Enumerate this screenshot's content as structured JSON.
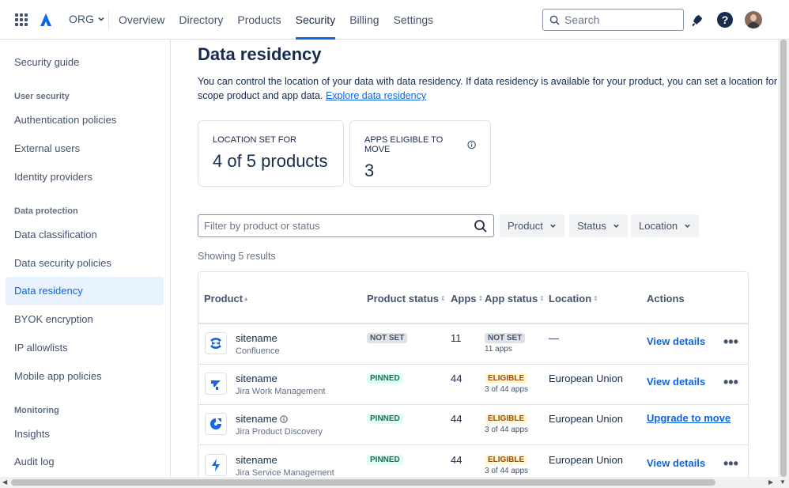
{
  "topnav": {
    "org_label": "ORG",
    "links": [
      "Overview",
      "Directory",
      "Products",
      "Security",
      "Billing",
      "Settings"
    ],
    "active_link": "Security",
    "search_placeholder": "Search",
    "help_glyph": "?",
    "accent_color": "#0c66e4"
  },
  "sidebar": {
    "security_guide": "Security guide",
    "user_security_heading": "User security",
    "authentication_policies": "Authentication policies",
    "external_users": "External users",
    "identity_providers": "Identity providers",
    "data_protection_heading": "Data protection",
    "data_classification": "Data classification",
    "data_security_policies": "Data security policies",
    "data_residency": "Data residency",
    "byok_encryption": "BYOK encryption",
    "ip_allowlists": "IP allowlists",
    "mobile_app_policies": "Mobile app policies",
    "monitoring_heading": "Monitoring",
    "insights": "Insights",
    "audit_log": "Audit log"
  },
  "main": {
    "title": "Data residency",
    "description": "You can control the location of your data with data residency. If data residency is available for your product, you can set a location for in-scope product and app data.",
    "description_link": "Explore data residency",
    "card_location": {
      "label": "LOCATION SET FOR",
      "value": "4 of 5 products"
    },
    "card_apps": {
      "label": "APPS ELIGIBLE TO MOVE",
      "value": "3"
    },
    "filter_placeholder": "Filter by product or status",
    "dropdowns": {
      "product": "Product",
      "status": "Status",
      "location": "Location"
    },
    "showing": "Showing 5 results"
  },
  "table": {
    "headers": {
      "product": "Product",
      "product_status": "Product status",
      "apps": "Apps",
      "app_status": "App status",
      "location": "Location",
      "actions": "Actions"
    },
    "rows": [
      {
        "name": "sitename",
        "product": "Confluence",
        "status": "NOT SET",
        "apps": "11",
        "app_status": "NOT SET",
        "app_sub": "11 apps",
        "location": "—",
        "action": "View details",
        "icon": "confluence-icon"
      },
      {
        "name": "sitename",
        "product": "Jira Work Management",
        "status": "PINNED",
        "apps": "44",
        "app_status": "ELIGIBLE",
        "app_sub": "3 of 44 apps",
        "location": "European Union",
        "action": "View details",
        "icon": "jira-work-management-icon"
      },
      {
        "name": "sitename",
        "product": "Jira Product Discovery",
        "status": "PINNED",
        "apps": "44",
        "app_status": "ELIGIBLE",
        "app_sub": "3 of 44 apps",
        "location": "European Union",
        "action": "Upgrade to move",
        "icon": "jira-product-discovery-icon"
      },
      {
        "name": "sitename",
        "product": "Jira Service Management",
        "status": "PINNED",
        "apps": "44",
        "app_status": "ELIGIBLE",
        "app_sub": "3 of 44 apps",
        "location": "European Union",
        "action": "View details",
        "icon": "jira-service-management-icon"
      }
    ]
  }
}
